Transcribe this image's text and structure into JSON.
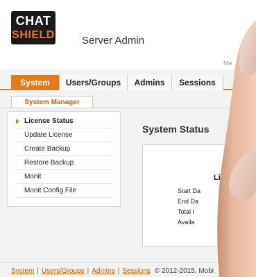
{
  "header": {
    "logo_line1": "CHAT",
    "logo_line2": "SHIELD",
    "title": "Server Admin",
    "faded_text": "Me"
  },
  "nav": {
    "tabs": [
      {
        "label": "System",
        "active": true
      },
      {
        "label": "Users/Groups",
        "active": false
      },
      {
        "label": "Admins",
        "active": false
      },
      {
        "label": "Sessions",
        "active": false
      }
    ]
  },
  "subnav": {
    "label": "System Manager"
  },
  "sidebar": {
    "items": [
      {
        "label": "License Status",
        "active": true
      },
      {
        "label": "Update License",
        "active": false
      },
      {
        "label": "Create Backup",
        "active": false
      },
      {
        "label": "Restore Backup",
        "active": false
      },
      {
        "label": "Monit",
        "active": false
      },
      {
        "label": "Monit Config File",
        "active": false
      }
    ]
  },
  "main": {
    "title": "System Status",
    "box_heading": "Lice",
    "rows": [
      "Start Da",
      "End Da",
      "Total l",
      "Availa"
    ]
  },
  "footer": {
    "links": [
      "System",
      "Users/Groups",
      "Admins",
      "Sessions"
    ],
    "copyright": "© 2012-2015, Mobi"
  },
  "colors": {
    "accent": "#e07b1f",
    "link": "#c65f00"
  }
}
